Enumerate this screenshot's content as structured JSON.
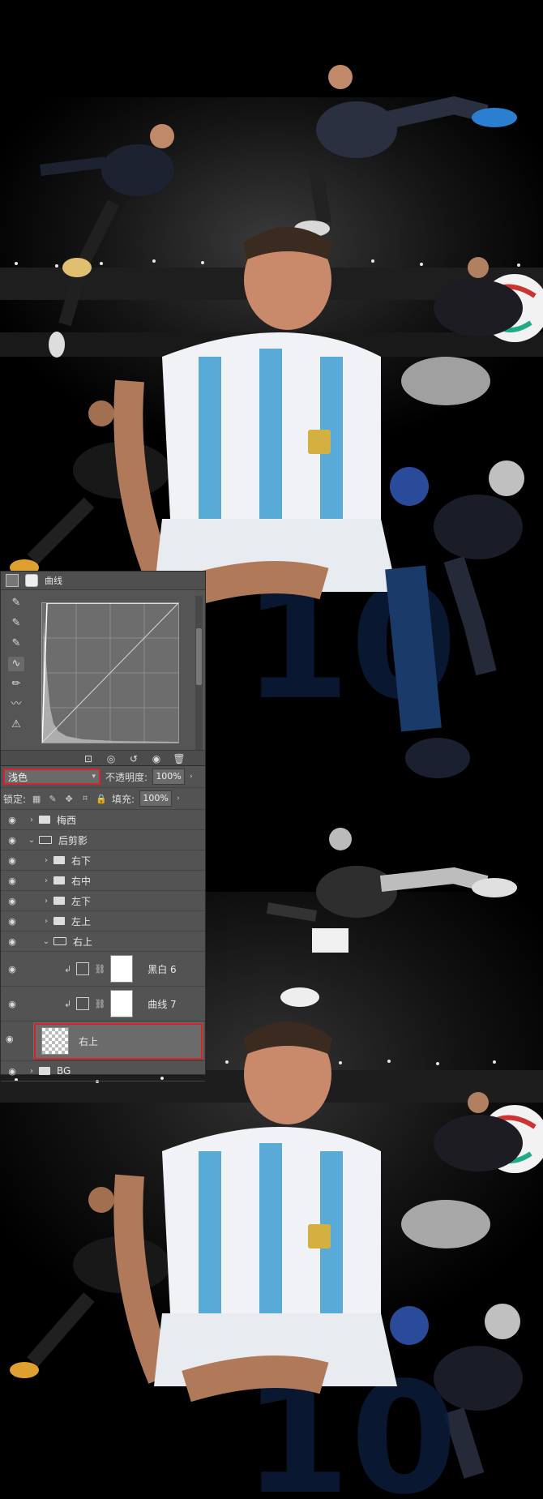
{
  "curves_panel": {
    "title": "曲线",
    "tools": [
      "eyedropper-black-icon",
      "eyedropper-gray-icon",
      "eyedropper-white-icon",
      "curve-point-icon",
      "pencil-icon",
      "smooth-icon",
      "clipping-warning-icon"
    ]
  },
  "layers_panel": {
    "blend_mode": "浅色",
    "opacity_label": "不透明度:",
    "opacity_value": "100%",
    "lock_label": "锁定:",
    "fill_label": "填充:",
    "fill_value": "100%",
    "layers": [
      {
        "name": "梅西",
        "type": "folder",
        "indent": 0,
        "expanded": false
      },
      {
        "name": "后剪影",
        "type": "folder",
        "indent": 0,
        "expanded": true
      },
      {
        "name": "右下",
        "type": "folder",
        "indent": 1,
        "expanded": false
      },
      {
        "name": "右中",
        "type": "folder",
        "indent": 1,
        "expanded": false
      },
      {
        "name": "左下",
        "type": "folder",
        "indent": 1,
        "expanded": false
      },
      {
        "name": "左上",
        "type": "folder",
        "indent": 1,
        "expanded": false
      },
      {
        "name": "右上",
        "type": "folder",
        "indent": 1,
        "expanded": true
      },
      {
        "name": "黑白 6",
        "type": "adjustment"
      },
      {
        "name": "曲线 7",
        "type": "adjustment"
      },
      {
        "name": "右上",
        "type": "layer",
        "selected": true
      },
      {
        "name": "BG",
        "type": "folder",
        "indent": 0,
        "expanded": false
      }
    ]
  },
  "colors": {
    "highlight": "#d0262c",
    "panel_bg": "#535353",
    "jersey_blue": "#5aaad8"
  }
}
